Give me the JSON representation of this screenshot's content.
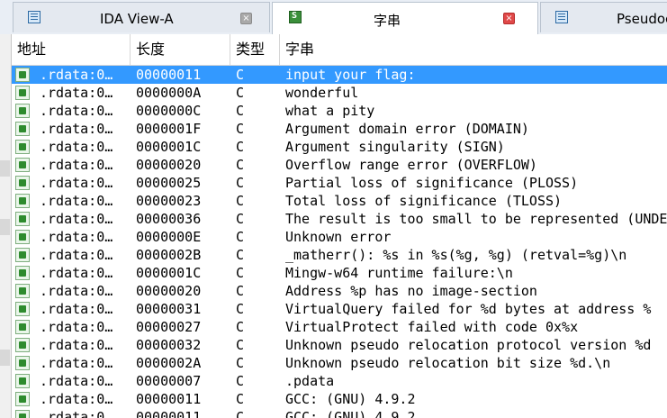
{
  "tabs": [
    {
      "label": "IDA View-A",
      "close": "×"
    },
    {
      "label": "字串",
      "close": "×"
    },
    {
      "label": "Pseudoc"
    }
  ],
  "columns": [
    "地址",
    "长度",
    "类型",
    "字串"
  ],
  "rows": [
    {
      "addr": ".rdata:0…",
      "len": "00000011",
      "type": "C",
      "str": "input your flag:"
    },
    {
      "addr": ".rdata:0…",
      "len": "0000000A",
      "type": "C",
      "str": "wonderful"
    },
    {
      "addr": ".rdata:0…",
      "len": "0000000C",
      "type": "C",
      "str": "what a pity"
    },
    {
      "addr": ".rdata:0…",
      "len": "0000001F",
      "type": "C",
      "str": "Argument domain error (DOMAIN)"
    },
    {
      "addr": ".rdata:0…",
      "len": "0000001C",
      "type": "C",
      "str": "Argument singularity (SIGN)"
    },
    {
      "addr": ".rdata:0…",
      "len": "00000020",
      "type": "C",
      "str": "Overflow range error (OVERFLOW)"
    },
    {
      "addr": ".rdata:0…",
      "len": "00000025",
      "type": "C",
      "str": "Partial loss of significance (PLOSS)"
    },
    {
      "addr": ".rdata:0…",
      "len": "00000023",
      "type": "C",
      "str": "Total loss of significance (TLOSS)"
    },
    {
      "addr": ".rdata:0…",
      "len": "00000036",
      "type": "C",
      "str": "The result is too small to be represented (UNDE"
    },
    {
      "addr": ".rdata:0…",
      "len": "0000000E",
      "type": "C",
      "str": "Unknown error"
    },
    {
      "addr": ".rdata:0…",
      "len": "0000002B",
      "type": "C",
      "str": "_matherr(): %s in %s(%g, %g)  (retval=%g)\\n"
    },
    {
      "addr": ".rdata:0…",
      "len": "0000001C",
      "type": "C",
      "str": "Mingw-w64 runtime failure:\\n"
    },
    {
      "addr": ".rdata:0…",
      "len": "00000020",
      "type": "C",
      "str": "Address %p has no image-section"
    },
    {
      "addr": ".rdata:0…",
      "len": "00000031",
      "type": "C",
      "str": "  VirtualQuery failed for %d bytes at address %"
    },
    {
      "addr": ".rdata:0…",
      "len": "00000027",
      "type": "C",
      "str": "  VirtualProtect failed with code 0x%x"
    },
    {
      "addr": ".rdata:0…",
      "len": "00000032",
      "type": "C",
      "str": "  Unknown pseudo relocation protocol version %d"
    },
    {
      "addr": ".rdata:0…",
      "len": "0000002A",
      "type": "C",
      "str": "  Unknown pseudo relocation bit size %d.\\n"
    },
    {
      "addr": ".rdata:0…",
      "len": "00000007",
      "type": "C",
      "str": ".pdata"
    },
    {
      "addr": ".rdata:0…",
      "len": "00000011",
      "type": "C",
      "str": "GCC: (GNU) 4.9.2"
    },
    {
      "addr": ".rdata:0…",
      "len": "00000011",
      "type": "C",
      "str": "GCC: (GNU) 4.9.2"
    }
  ],
  "selected_index": 0,
  "colors": {
    "selection": "#3399ff",
    "close_active": "#e04848"
  }
}
